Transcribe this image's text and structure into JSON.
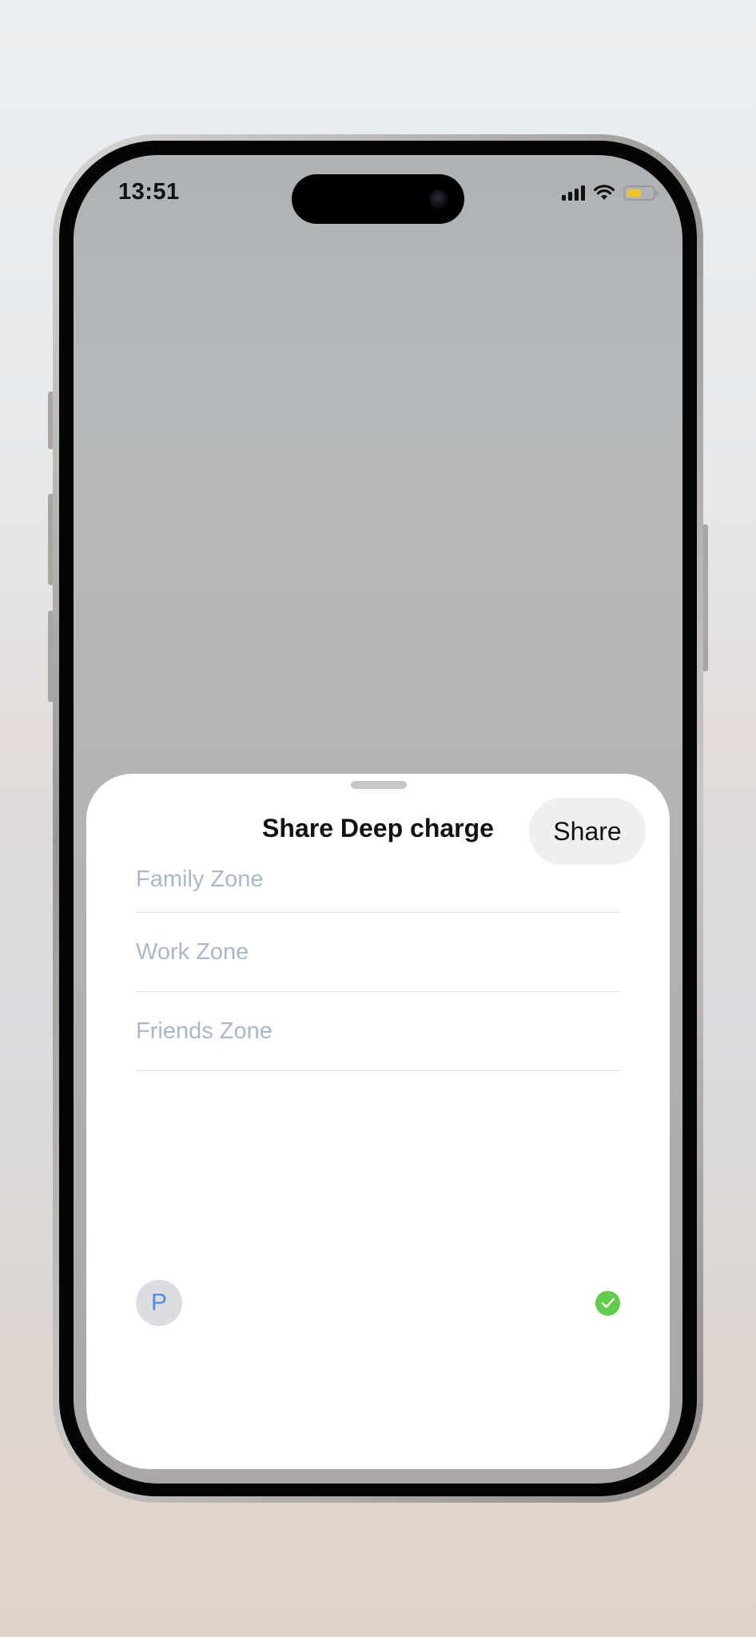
{
  "status_bar": {
    "time": "13:51",
    "battery_color": "#f3c51c"
  },
  "sheet": {
    "title": "Share Deep charge",
    "share_label": "Share",
    "zones": [
      {
        "label": "Family Zone"
      },
      {
        "label": "Work Zone"
      },
      {
        "label": "Friends Zone"
      }
    ],
    "contact": {
      "initial": "P",
      "selected": true,
      "check_color": "#5fcc4c"
    }
  }
}
